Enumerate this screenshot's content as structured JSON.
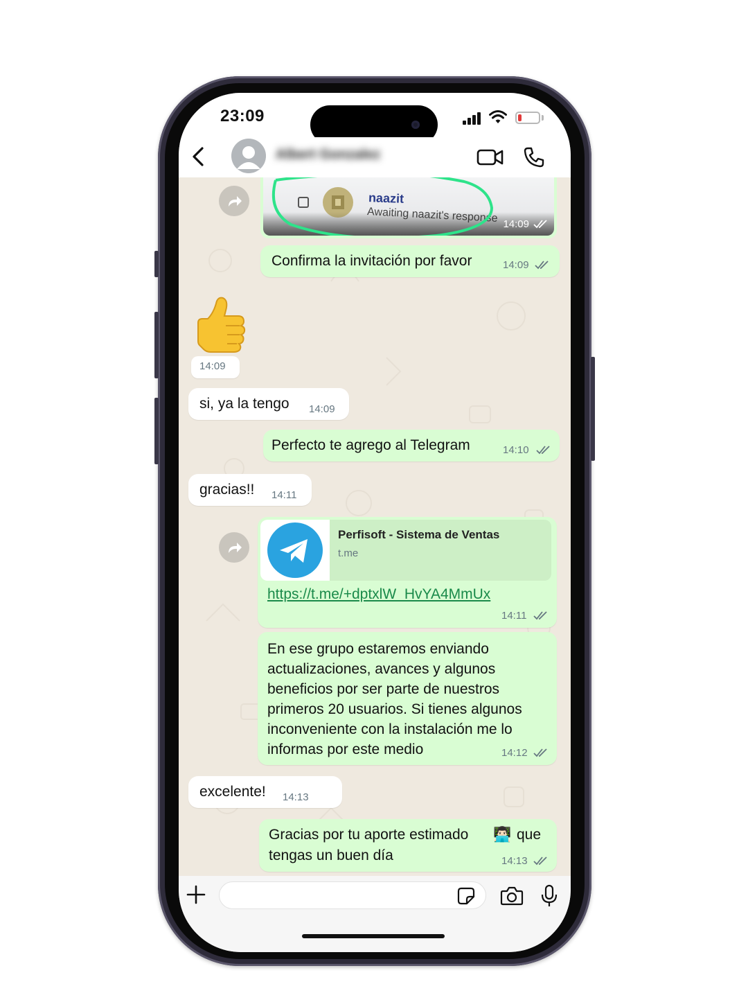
{
  "status_bar": {
    "time": "23:09"
  },
  "header": {
    "contact_name": "Albert Gonzalez"
  },
  "messages": {
    "image_msg": {
      "name": "naazit",
      "status": "Awaiting naazit's response",
      "time": "14:09"
    },
    "m1": {
      "text": "Confirma la invitación por favor",
      "time": "14:09"
    },
    "m2": {
      "emoji": "thumbs-up",
      "time": "14:09"
    },
    "m3": {
      "text": "si, ya la tengo",
      "time": "14:09"
    },
    "m4": {
      "text": "Perfecto te agrego al Telegram",
      "time": "14:10"
    },
    "m5": {
      "text": "gracias!!",
      "time": "14:11"
    },
    "m6": {
      "preview_title": "Perfisoft - Sistema de Ventas",
      "preview_domain": "t.me",
      "url": "https://t.me/+dptxlW_HvYA4MmUx",
      "time": "14:11"
    },
    "m7": {
      "lines": [
        "En ese grupo estaremos enviando",
        "actualizaciones, avances y algunos",
        "beneficios por ser parte de nuestros",
        "primeros 20 usuarios. Si tienes algunos",
        "inconveniente con la instalación me lo",
        "informas por este medio"
      ],
      "time": "14:12"
    },
    "m8": {
      "text": "excelente!",
      "time": "14:13"
    },
    "m9": {
      "line1": "Gracias por tu aporte estimado",
      "emoji": "👨🏻‍💻",
      "line1_end": "que",
      "line2": "tengas un buen día",
      "time": "14:13"
    }
  },
  "icons": {
    "back": "chevron-left-icon",
    "video": "video-call-icon",
    "call": "phone-icon",
    "plus": "plus-icon",
    "sticker": "sticker-icon",
    "camera": "camera-icon",
    "mic": "microphone-icon"
  },
  "colors": {
    "outgoing_bubble": "#d9fdd3",
    "incoming_bubble": "#ffffff",
    "chat_background": "#efe9df",
    "link": "#1a8a4a",
    "read_ticks": "#667781",
    "telegram": "#2aa3e0",
    "highlight_circle": "#2ee38a"
  }
}
